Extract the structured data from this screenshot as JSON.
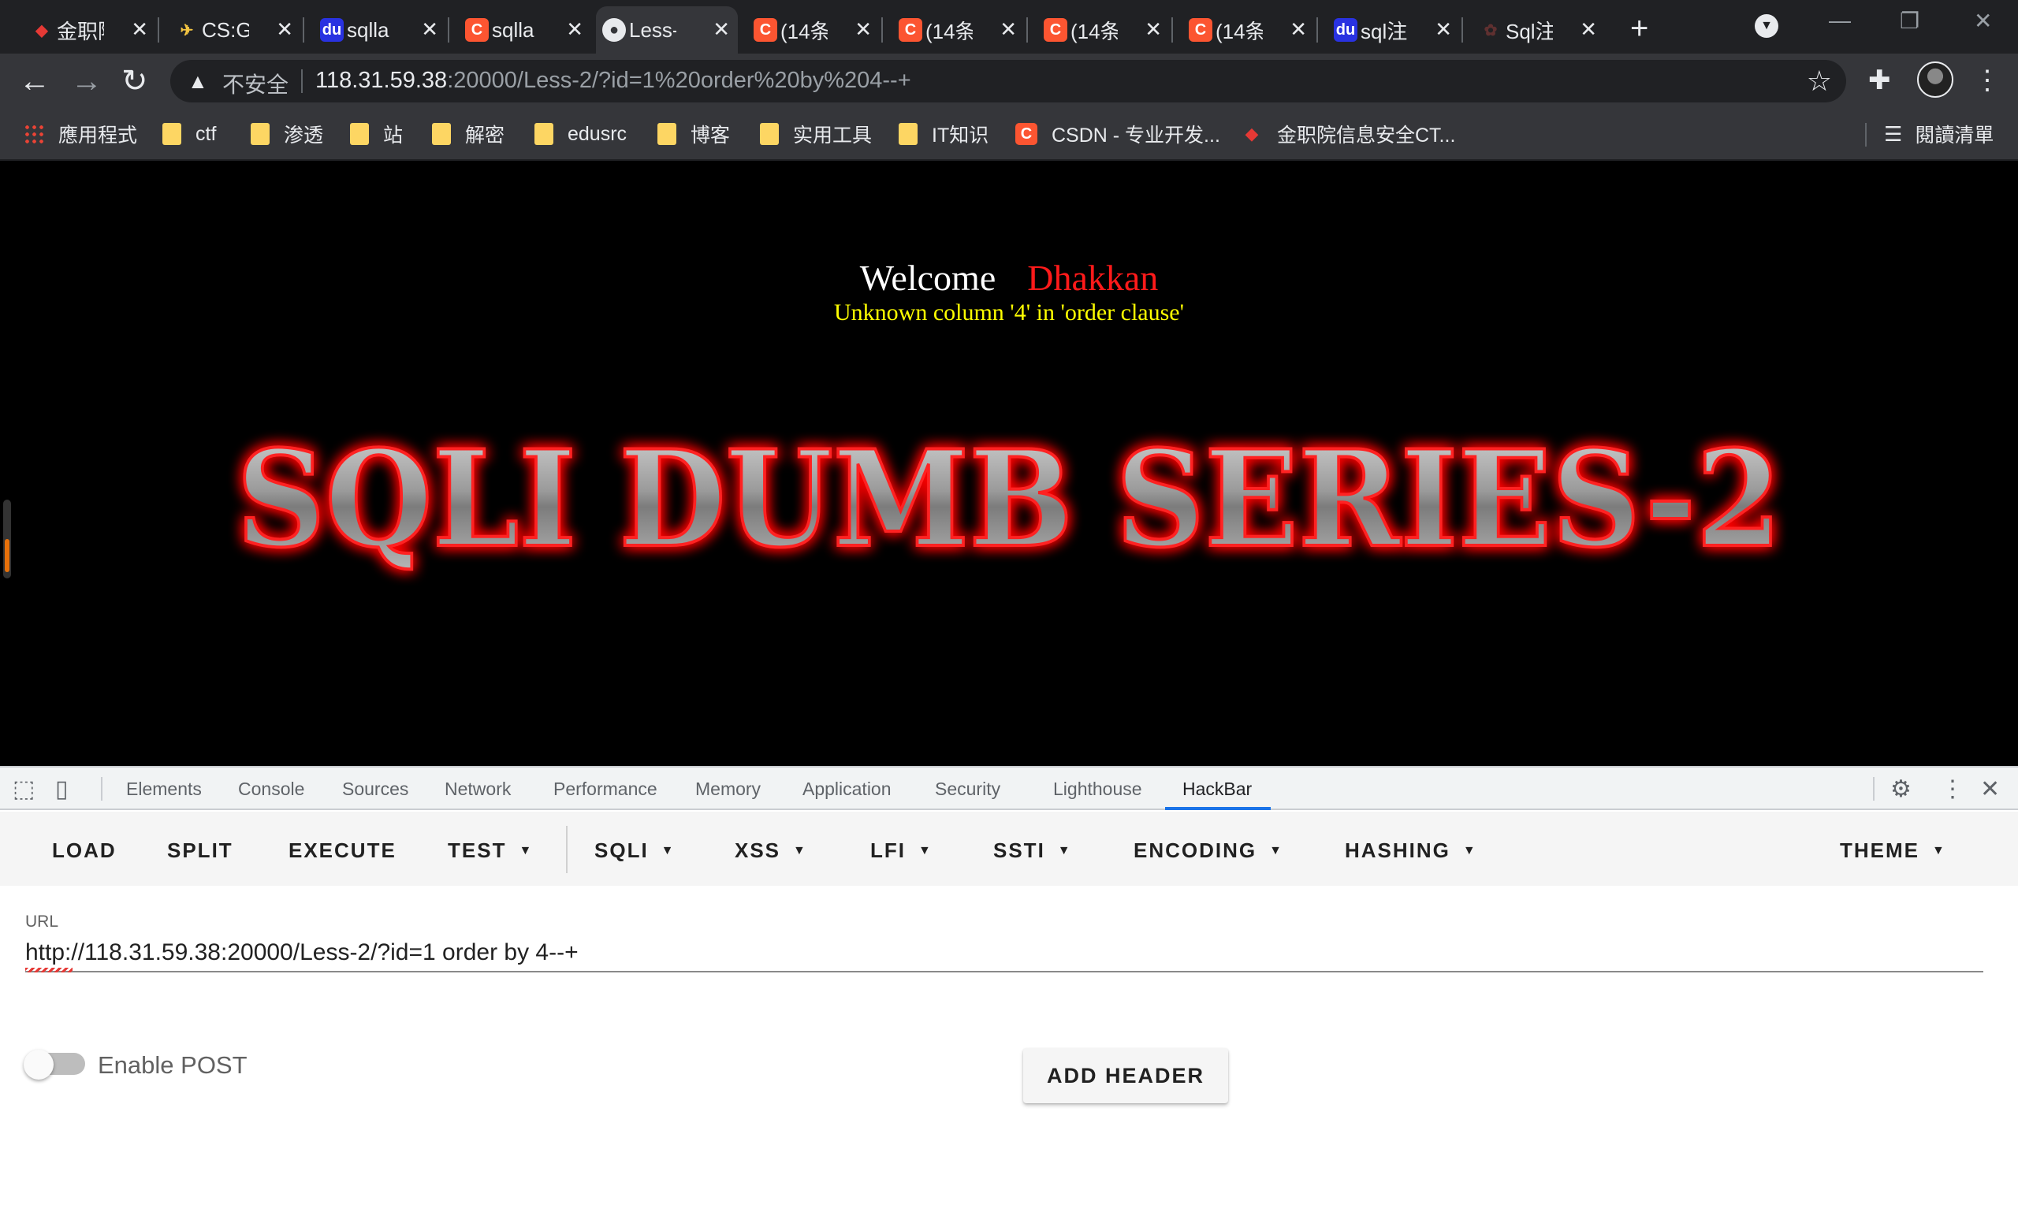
{
  "browser": {
    "tabs": [
      {
        "label": "金职院",
        "icon": "jinzhi-favicon"
      },
      {
        "label": "CS:GO",
        "icon": "bird-favicon"
      },
      {
        "label": "sqlla",
        "icon": "baidu-favicon"
      },
      {
        "label": "sqlla",
        "icon": "csdn-favicon"
      },
      {
        "label": "Less-",
        "icon": "globe-favicon",
        "active": true
      },
      {
        "label": "(14条",
        "icon": "csdn-favicon"
      },
      {
        "label": "(14条",
        "icon": "csdn-favicon"
      },
      {
        "label": "(14条",
        "icon": "csdn-favicon"
      },
      {
        "label": "(14条",
        "icon": "csdn-favicon"
      },
      {
        "label": "sql注",
        "icon": "baidu-favicon"
      },
      {
        "label": "Sql注",
        "icon": "dim-favicon"
      }
    ],
    "address": {
      "security_label": "不安全",
      "host": "118.31.59.38",
      "rest": ":20000/Less-2/?id=1%20order%20by%204--+"
    },
    "bookmarks": [
      {
        "label": "應用程式",
        "icon": "apps-icon"
      },
      {
        "label": "ctf",
        "icon": "folder-icon"
      },
      {
        "label": "渗透",
        "icon": "folder-icon"
      },
      {
        "label": "站",
        "icon": "folder-icon"
      },
      {
        "label": "解密",
        "icon": "folder-icon"
      },
      {
        "label": "edusrc",
        "icon": "folder-icon"
      },
      {
        "label": "博客",
        "icon": "folder-icon"
      },
      {
        "label": "实用工具",
        "icon": "folder-icon"
      },
      {
        "label": "IT知识",
        "icon": "folder-icon"
      },
      {
        "label": "CSDN - 专业开发...",
        "icon": "csdn-favicon"
      },
      {
        "label": "金职院信息安全CT...",
        "icon": "jinzhi-favicon"
      }
    ],
    "reading_list": "閱讀清單"
  },
  "page": {
    "welcome": "Welcome",
    "user": "Dhakkan",
    "error": "Unknown column '4' in 'order clause'",
    "banner_text": "SQLI DUMB SERIES-2"
  },
  "devtools": {
    "tabs": [
      "Elements",
      "Console",
      "Sources",
      "Network",
      "Performance",
      "Memory",
      "Application",
      "Security",
      "Lighthouse",
      "HackBar"
    ],
    "active_tab": "HackBar"
  },
  "hackbar": {
    "menu": [
      "LOAD",
      "SPLIT",
      "EXECUTE",
      "TEST",
      "SQLI",
      "XSS",
      "LFI",
      "SSTI",
      "ENCODING",
      "HASHING",
      "THEME"
    ],
    "url_label": "URL",
    "url_value": "http://118.31.59.38:20000/Less-2/?id=1 order by 4--+",
    "enable_post_label": "Enable POST",
    "enable_post": false,
    "add_header_label": "ADD HEADER"
  },
  "colors": {
    "tabstrip_bg": "#202124",
    "toolbar_bg": "#35363a",
    "page_bg": "#000000",
    "welcome_name": "#ff1a1a",
    "error_text": "#ffff00",
    "devtools_accent": "#1a73e8"
  }
}
